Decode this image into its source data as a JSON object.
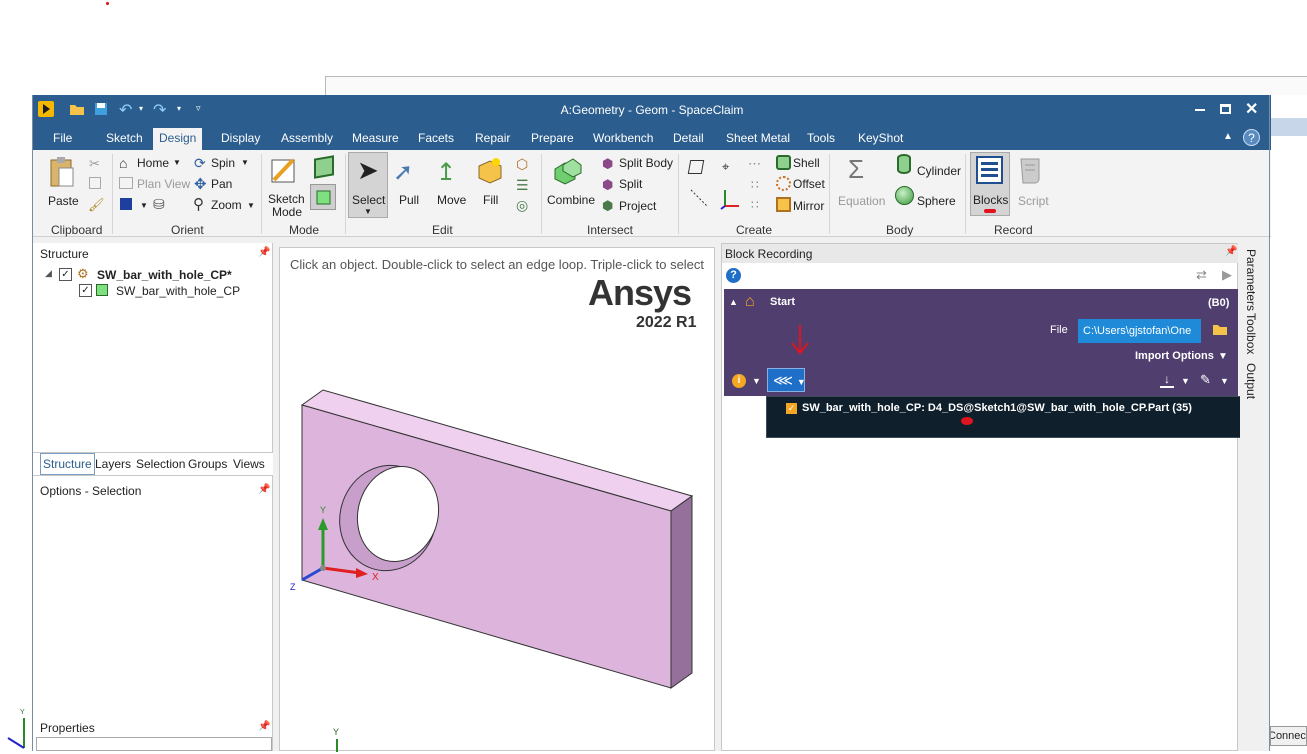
{
  "window": {
    "title": "A:Geometry - Geom - SpaceClaim"
  },
  "menu": {
    "tabs": [
      "File",
      "Sketch",
      "Design",
      "Display",
      "Assembly",
      "Measure",
      "Facets",
      "Repair",
      "Prepare",
      "Workbench",
      "Detail",
      "Sheet Metal",
      "Tools",
      "KeyShot"
    ],
    "active": "Design"
  },
  "ribbon": {
    "clipboard": {
      "label": "Clipboard",
      "paste": "Paste"
    },
    "orient": {
      "label": "Orient",
      "home": "Home",
      "plan_view": "Plan View",
      "zoom": "Zoom",
      "spin": "Spin",
      "pan": "Pan"
    },
    "mode": {
      "label": "Mode",
      "sketch_mode_1": "Sketch",
      "sketch_mode_2": "Mode"
    },
    "edit": {
      "label": "Edit",
      "select": "Select",
      "pull": "Pull",
      "move": "Move",
      "fill": "Fill"
    },
    "intersect": {
      "label": "Intersect",
      "combine": "Combine",
      "split_body": "Split Body",
      "split": "Split",
      "project": "Project"
    },
    "create": {
      "label": "Create",
      "shell": "Shell",
      "offset": "Offset",
      "mirror": "Mirror"
    },
    "body": {
      "label": "Body",
      "equation": "Equation",
      "cylinder": "Cylinder",
      "sphere": "Sphere"
    },
    "record": {
      "label": "Record",
      "blocks": "Blocks",
      "script": "Script"
    }
  },
  "structure": {
    "header": "Structure",
    "root": "SW_bar_with_hole_CP*",
    "child": "SW_bar_with_hole_CP",
    "tabs": [
      "Structure",
      "Layers",
      "Selection",
      "Groups",
      "Views"
    ]
  },
  "options": {
    "header": "Options - Selection"
  },
  "properties": {
    "header": "Properties"
  },
  "viewport": {
    "hint": "Click an object. Double-click to select an edge loop. Triple-click to select",
    "logo": "Ansys",
    "version": "2022 R1",
    "axis_x": "X",
    "axis_y": "Y",
    "axis_z": "Z"
  },
  "block_recording": {
    "header": "Block Recording",
    "start": "Start",
    "start_id": "(B0)",
    "file_label": "File",
    "file_value": "C:\\Users\\gjstofan\\One",
    "import_options": "Import Options",
    "entry": "SW_bar_with_hole_CP: D4_DS@Sketch1@SW_bar_with_hole_CP.Part (35)"
  },
  "side_tabs": [
    "Parameters",
    "Toolbox",
    "Output"
  ],
  "status": {
    "connect": "Connect"
  },
  "colors": {
    "titlebar": "#2b5d8e",
    "purple_panel": "#4f3e6e",
    "model_face": "#dcb4dc",
    "accent_red": "#e0141e"
  }
}
